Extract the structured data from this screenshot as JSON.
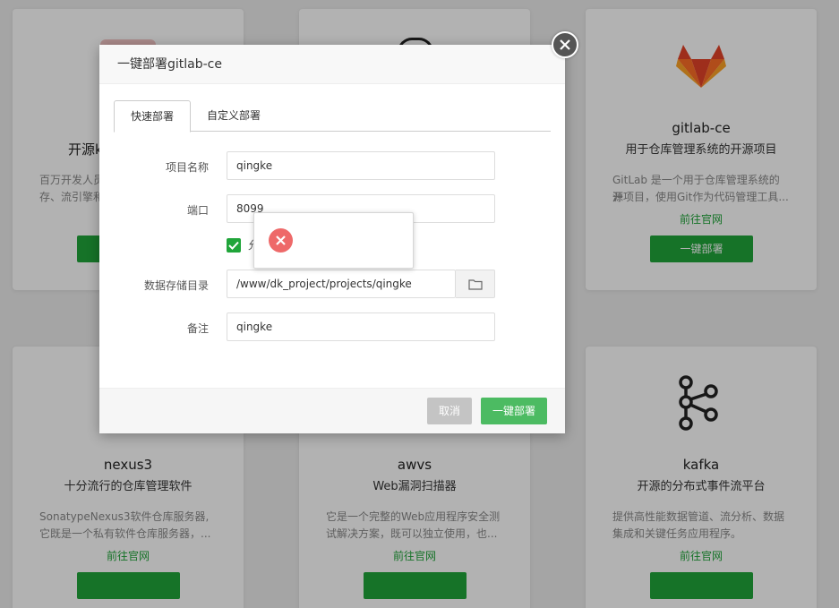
{
  "cards_top": [
    {
      "name": "开源k",
      "subtitle": "",
      "desc_line1": "百万开发人员",
      "desc_line2": "存、流引擎和",
      "link": "",
      "button": ""
    },
    {
      "name": "",
      "subtitle": "",
      "desc_line1": "",
      "desc_line2": "",
      "link": "",
      "button": ""
    },
    {
      "name": "gitlab-ce",
      "subtitle": "用于仓库管理系统的开源项目",
      "desc_line1": "GitLab 是一个用于仓库管理系统的开",
      "desc_line2": "源项目，使用Git作为代码管理工具...",
      "link": "前往官网",
      "button": "一键部署"
    }
  ],
  "cards_bottom": [
    {
      "name": "nexus3",
      "subtitle": "十分流行的仓库管理软件",
      "desc_line1": "SonatypeNexus3软件仓库服务器,",
      "desc_line2": "它既是一个私有软件仓库服务器，...",
      "link": "前往官网"
    },
    {
      "name": "awvs",
      "subtitle": "Web漏洞扫描器",
      "desc_line1": "它是一个完整的Web应用程序安全测",
      "desc_line2": "试解决方案，既可以独立使用，也...",
      "link": "前往官网"
    },
    {
      "name": "kafka",
      "subtitle": "开源的分布式事件流平台",
      "desc_line1": "提供高性能数据管道、流分析、数据",
      "desc_line2": "集成和关键任务应用程序。",
      "link": "前往官网"
    }
  ],
  "dialog": {
    "title": "一键部署gitlab-ce",
    "tabs": [
      "快速部署",
      "自定义部署"
    ],
    "fields": {
      "project_name_label": "项目名称",
      "project_name_value": "qingke",
      "port_label": "端口",
      "port_value": "8099",
      "checkbox_label": "允",
      "data_dir_label": "数据存储目录",
      "data_dir_value": "/www/dk_project/projects/qingke",
      "remark_label": "备注",
      "remark_value": "qingke"
    },
    "cancel_label": "取消",
    "confirm_label": "一键部署"
  },
  "toast": {
    "type": "error",
    "message": ""
  },
  "colors": {
    "brand_green": "#20a53a",
    "confirm_green": "#4cbb62",
    "error_red": "#ee6969"
  }
}
